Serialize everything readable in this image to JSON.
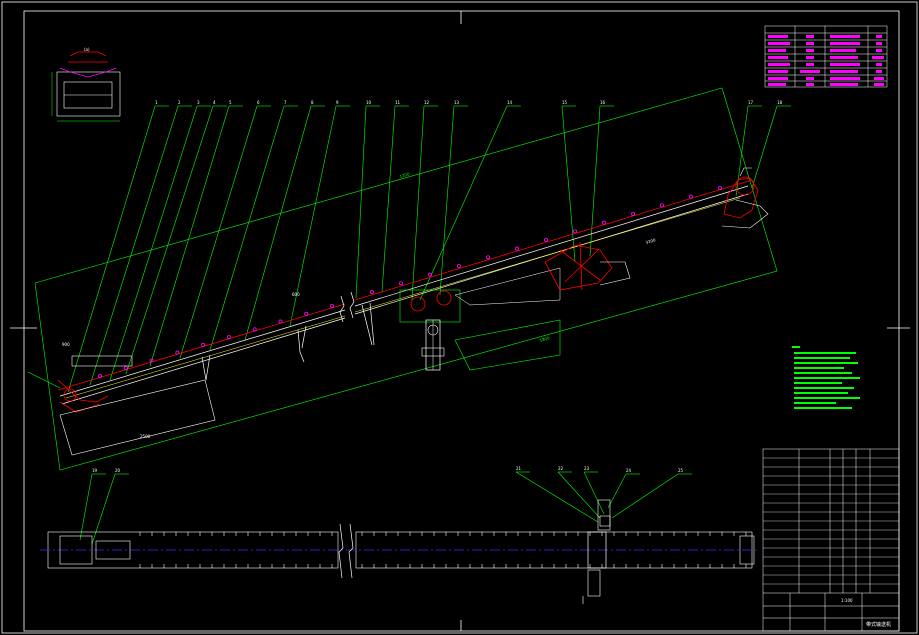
{
  "drawing": {
    "scale_text": "1:100",
    "title_text": "带式输送机",
    "part_numbers_top": [
      "1",
      "2",
      "3",
      "4",
      "5",
      "6",
      "7",
      "8",
      "9",
      "10",
      "11",
      "12",
      "13",
      "14",
      "15",
      "16",
      "17",
      "18"
    ],
    "part_numbers_plan": [
      "19",
      "20",
      "21",
      "22",
      "23",
      "24",
      "25"
    ],
    "dim_texts": [
      "1200",
      "2500",
      "1800",
      "3200",
      "900",
      "600"
    ]
  },
  "colors": {
    "background": "#000000",
    "frame": "#ffffff",
    "leader": "#00ff00",
    "belt": "#ff0000",
    "idler": "#ff00ff",
    "centerline": "#3030ff",
    "outline": "#ffffff",
    "note": "#00ff00"
  }
}
